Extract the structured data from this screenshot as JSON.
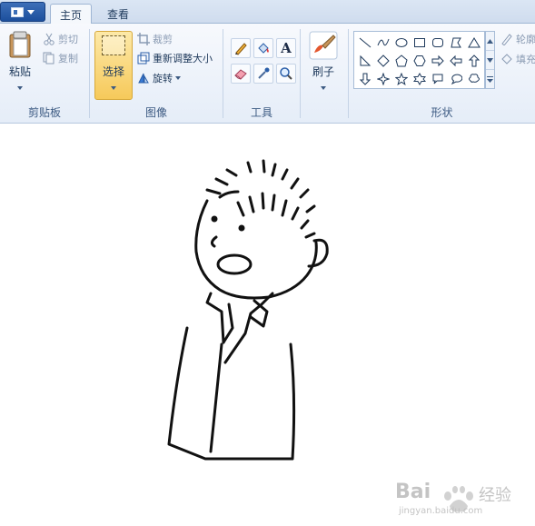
{
  "tabs": {
    "home": "主页",
    "view": "查看"
  },
  "clipboard": {
    "paste": "粘贴",
    "cut": "剪切",
    "copy": "复制",
    "group_label": "剪贴板"
  },
  "image": {
    "select": "选择",
    "crop": "裁剪",
    "resize": "重新调整大小",
    "rotate": "旋转",
    "group_label": "图像"
  },
  "tools": {
    "group_label": "工具",
    "text_tool_glyph": "A"
  },
  "brushes": {
    "label": "刷子"
  },
  "shapes": {
    "group_label": "形状",
    "outline": "轮廓",
    "fill": "填充"
  },
  "watermark": {
    "brand": "Bai",
    "brand2": "经验",
    "url": "jingyan.baidu.com"
  },
  "colors": {
    "accent_select": "#f6c95a",
    "ribbon_bg": "#e5edf8",
    "app_button": "#1c4f9c"
  }
}
